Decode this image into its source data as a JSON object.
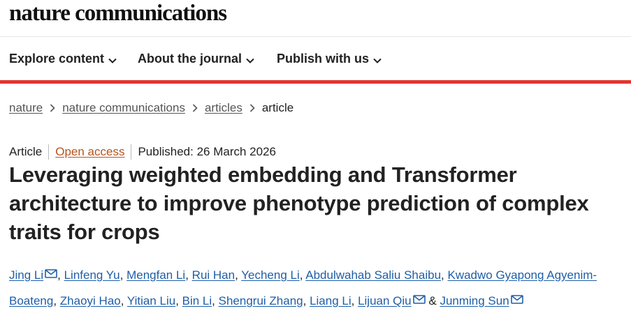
{
  "site": {
    "logo": "nature communications"
  },
  "nav": {
    "items": [
      {
        "label": "Explore content"
      },
      {
        "label": "About the journal"
      },
      {
        "label": "Publish with us"
      }
    ]
  },
  "breadcrumb": {
    "items": [
      "nature",
      "nature communications",
      "articles"
    ],
    "current": "article"
  },
  "article": {
    "type": "Article",
    "access": "Open access",
    "published": "Published: 26 March 2026",
    "title": "Leveraging weighted embedding and Transformer architecture to improve phenotype prediction of complex traits for crops",
    "authors": [
      {
        "name": "Jing Li",
        "mail": true
      },
      {
        "name": "Linfeng Yu",
        "mail": false
      },
      {
        "name": "Mengfan Li",
        "mail": false
      },
      {
        "name": "Rui Han",
        "mail": false
      },
      {
        "name": "Yecheng Li",
        "mail": false
      },
      {
        "name": "Abdulwahab Saliu Shaibu",
        "mail": false
      },
      {
        "name": "Kwadwo Gyapong Agyenim-Boateng",
        "mail": false
      },
      {
        "name": "Zhaoyi Hao",
        "mail": false
      },
      {
        "name": "Yitian Liu",
        "mail": false
      },
      {
        "name": "Bin Li",
        "mail": false
      },
      {
        "name": "Shengrui Zhang",
        "mail": false
      },
      {
        "name": "Liang Li",
        "mail": false
      },
      {
        "name": "Lijuan Qiu",
        "mail": true
      },
      {
        "name": "Junming Sun",
        "mail": true
      }
    ],
    "author_separator": ", ",
    "last_separator": " & "
  },
  "colors": {
    "accent_rule": "#e3342f",
    "author_link": "#1f5ea8",
    "open_access": "#b5541e"
  },
  "icons": {
    "nav_chevron": "chevron-down-icon",
    "breadcrumb_separator": "chevron-right-icon",
    "author_contact": "mail-icon"
  }
}
